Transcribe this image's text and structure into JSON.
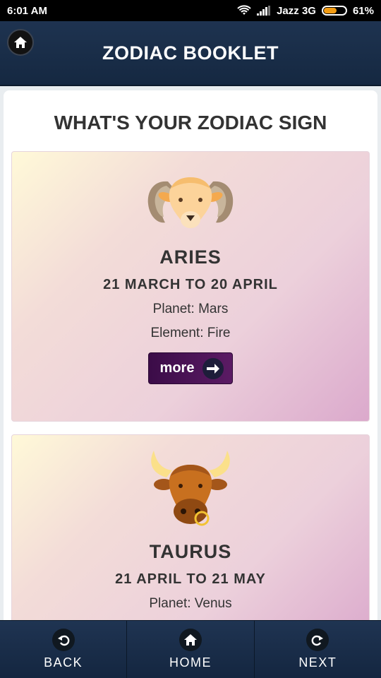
{
  "status_bar": {
    "time": "6:01 AM",
    "carrier": "Jazz 3G",
    "battery_percent_label": "61%",
    "battery_level": 0.61,
    "icons": [
      "wifi-icon",
      "signal-icon",
      "battery-icon"
    ]
  },
  "header": {
    "title": "ZODIAC BOOKLET",
    "home_icon": "home-icon"
  },
  "section": {
    "title": "WHAT'S YOUR ZODIAC SIGN"
  },
  "signs": [
    {
      "name": "ARIES",
      "dates": "21 MARCH TO 20 APRIL",
      "planet": "Planet: Mars",
      "element": "Element: Fire",
      "more_label": "more",
      "icon": "ram-icon"
    },
    {
      "name": "TAURUS",
      "dates": "21 APRIL TO 21 MAY",
      "planet": "Planet: Venus",
      "icon": "bull-icon"
    }
  ],
  "bottom_nav": {
    "back_label": "BACK",
    "home_label": "HOME",
    "next_label": "NEXT"
  },
  "colors": {
    "header_bg": "#1e3350",
    "button_bg": "#3b0c48",
    "battery": "#f39c12"
  }
}
